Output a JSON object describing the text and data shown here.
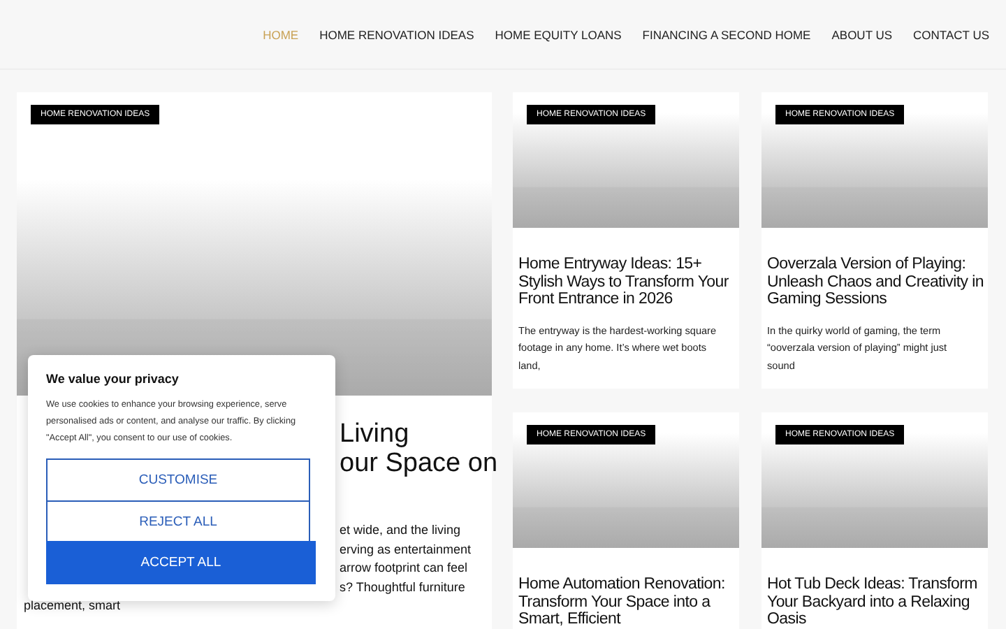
{
  "nav": [
    {
      "label": "HOME",
      "selected": true
    },
    {
      "label": "HOME RENOVATION IDEAS",
      "selected": false
    },
    {
      "label": "HOME EQUITY LOANS",
      "selected": false
    },
    {
      "label": "FINANCING A SECOND HOME",
      "selected": false
    },
    {
      "label": "ABOUT US",
      "selected": false
    },
    {
      "label": "CONTACT US",
      "selected": false
    }
  ],
  "featured": {
    "tag": "HOME RENOVATION IDEAS",
    "title_lines": [
      "Living",
      "our Space on"
    ],
    "excerpt_lines": [
      {
        "text": "et wide, and the living",
        "kind": "right"
      },
      {
        "text": "erving as entertainment",
        "kind": "right"
      },
      {
        "text": "arrow footprint can feel",
        "kind": "right"
      },
      {
        "text": "s? Thoughtful furniture",
        "kind": "right"
      },
      {
        "text": "placement, smart",
        "kind": "full"
      }
    ]
  },
  "posts": [
    {
      "tag": "HOME RENOVATION IDEAS",
      "title": "Home Entryway Ideas: 15+ Stylish Ways to Transform Your Front Entrance in 2026",
      "excerpt": "The entryway is the hardest-working square footage in any home. It’s where wet boots land,"
    },
    {
      "tag": "HOME RENOVATION IDEAS",
      "title": "Ooverzala Version of Playing: Unleash Chaos and Creativity in Gaming Sessions",
      "excerpt": "In the quirky world of gaming, the term “ooverzala version of playing” might just sound"
    },
    {
      "tag": "HOME RENOVATION IDEAS",
      "title": "Home Automation Renovation: Transform Your Space into a Smart, Efficient"
    },
    {
      "tag": "HOME RENOVATION IDEAS",
      "title": "Hot Tub Deck Ideas: Transform Your Backyard into a Relaxing Oasis"
    }
  ],
  "cookie_dialog": {
    "title": "We value your privacy",
    "text": "We use cookies to enhance your browsing experience, serve personalised ads or content, and analyse our traffic. By clicking \"Accept All\", you consent to our use of cookies.",
    "buttons": [
      {
        "label": "CUSTOMISE",
        "kind": "outline"
      },
      {
        "label": "REJECT ALL",
        "kind": "outline"
      },
      {
        "label": "ACCEPT ALL",
        "kind": "primary"
      }
    ]
  }
}
